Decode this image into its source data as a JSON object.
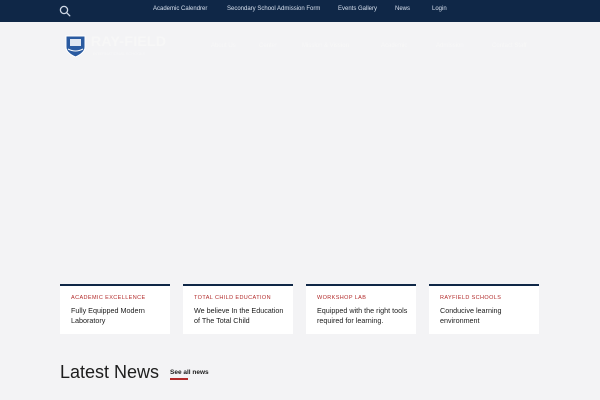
{
  "topbar": {
    "search_icon": "search-icon",
    "links": [
      "Academic Calendrer",
      "Secondary School Admission Form",
      "Events Gallery",
      "News",
      "Login"
    ]
  },
  "header": {
    "logo_text": "RAY-FIELD",
    "logo_tagline": "INTERNATIONAL SCHOOLS",
    "nav": [
      "About Us",
      "Center",
      "Mission & Vission",
      "Academic",
      "Admission",
      "Contact Staff"
    ]
  },
  "cards": [
    {
      "kicker": "ACADEMIC EXCELLENCE",
      "text": "Fully Equipped Modern Laboratory"
    },
    {
      "kicker": "TOTAL CHILD EDUCATION",
      "text": "We believe In the Education of The Total Child"
    },
    {
      "kicker": "WORKSHOP LAB",
      "text": "Equipped with the right tools required for learning."
    },
    {
      "kicker": "RAYFIELD SCHOOLS",
      "text": "Conducive learning environment"
    }
  ],
  "latest": {
    "title": "Latest News",
    "see_all": "See all news"
  },
  "colors": {
    "topbar": "#0f2747",
    "accent": "#b22a2a",
    "background": "#f3f3f5"
  }
}
